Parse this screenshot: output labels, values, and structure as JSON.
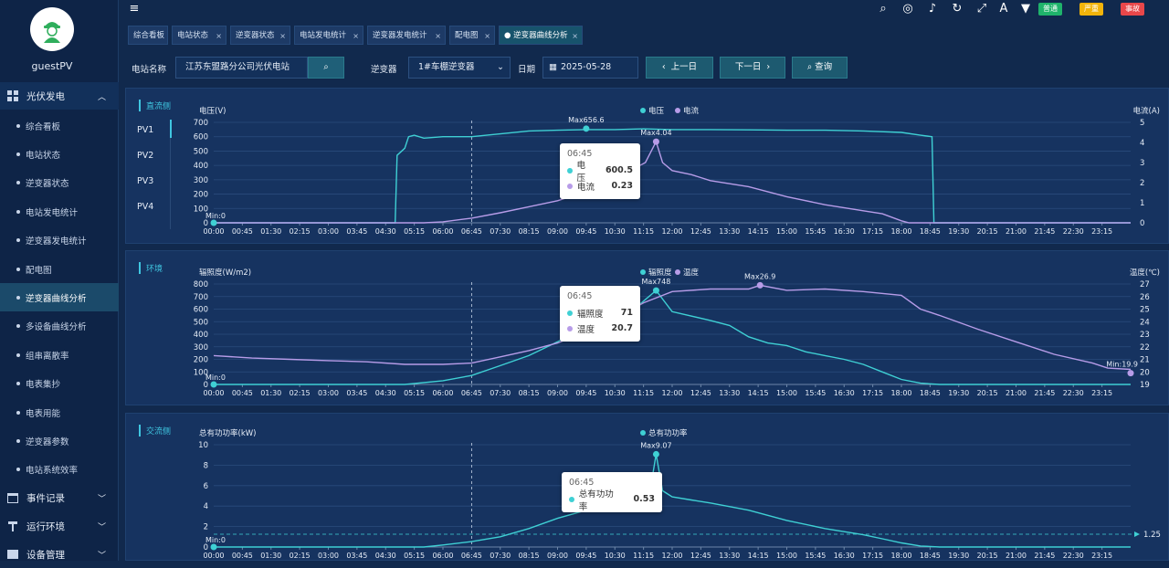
{
  "user": {
    "name": "guestPV"
  },
  "sidebar": {
    "groups": [
      {
        "label": "光伏发电",
        "expanded": true
      },
      {
        "label": "事件记录",
        "expanded": false
      },
      {
        "label": "运行环境",
        "expanded": false
      },
      {
        "label": "设备管理",
        "expanded": false
      }
    ],
    "items": [
      "综合看板",
      "电站状态",
      "逆变器状态",
      "电站发电统计",
      "逆变器发电统计",
      "配电图",
      "逆变器曲线分析",
      "多设备曲线分析",
      "组串离散率",
      "电表集抄",
      "电表用能",
      "逆变器参数",
      "电站系统效率"
    ],
    "active_item": "逆变器曲线分析"
  },
  "topbar": {
    "badges": [
      {
        "label": "普通",
        "color": "#1fb36b"
      },
      {
        "label": "严重",
        "color": "#f2b40a"
      },
      {
        "label": "事故",
        "color": "#e8474a"
      }
    ]
  },
  "tabs": [
    "综合看板",
    "电站状态",
    "逆变器状态",
    "电站发电统计",
    "逆变器发电统计",
    "配电图",
    "逆变器曲线分析"
  ],
  "active_tab": "逆变器曲线分析",
  "filter": {
    "station_label": "电站名称",
    "station_value": "江苏东盟路分公司光伏电站",
    "inverter_label": "逆变器",
    "inverter_value": "1#车棚逆变器",
    "date_label": "日期",
    "date_value": "2025-05-28",
    "prev_label": "上一日",
    "next_label": "下一日",
    "query_label": "查询"
  },
  "dc_panel": {
    "title": "直流侧",
    "pv_list": [
      "PV1",
      "PV2",
      "PV3",
      "PV4"
    ],
    "tooltip": {
      "time": "06:45",
      "rows": [
        {
          "name": "电压",
          "value": "600.5"
        },
        {
          "name": "电流",
          "value": "0.23"
        }
      ]
    }
  },
  "env_panel": {
    "title": "环境",
    "tooltip": {
      "time": "06:45",
      "rows": [
        {
          "name": "辐照度",
          "value": "71"
        },
        {
          "name": "温度",
          "value": "20.7"
        }
      ]
    }
  },
  "ac_panel": {
    "title": "交流侧",
    "tooltip": {
      "time": "06:45",
      "rows": [
        {
          "name": "总有功功率",
          "value": "0.53"
        }
      ]
    }
  },
  "chart_data": [
    {
      "type": "line",
      "x_ticks": [
        "00:00",
        "00:45",
        "01:30",
        "02:15",
        "03:00",
        "03:45",
        "04:30",
        "05:15",
        "06:00",
        "06:45",
        "07:30",
        "08:15",
        "09:00",
        "09:45",
        "10:30",
        "11:15",
        "12:00",
        "12:45",
        "13:30",
        "14:15",
        "15:00",
        "15:45",
        "16:30",
        "17:15",
        "18:00",
        "18:45",
        "19:30",
        "20:15",
        "21:00",
        "21:45",
        "22:30",
        "23:15"
      ],
      "ylabel": "电压(V)",
      "ylim": [
        0,
        700
      ],
      "y_ticks": [
        0,
        100,
        200,
        300,
        400,
        500,
        600,
        700
      ],
      "y2label": "电流(A)",
      "y2lim": [
        0,
        5
      ],
      "y2_ticks": [
        0,
        1,
        2,
        3,
        4,
        5
      ],
      "legend": [
        "电压",
        "电流"
      ],
      "series": [
        {
          "name": "电压",
          "axis": "left",
          "color": "#3fd0d4",
          "points": [
            [
              0,
              0
            ],
            [
              4.75,
              0
            ],
            [
              4.8,
              470
            ],
            [
              5.0,
              520
            ],
            [
              5.1,
              600
            ],
            [
              5.25,
              610
            ],
            [
              5.5,
              590
            ],
            [
              6.0,
              600
            ],
            [
              6.75,
              600
            ],
            [
              7.5,
              620
            ],
            [
              8.25,
              640
            ],
            [
              9.0,
              645
            ],
            [
              9.75,
              650
            ],
            [
              10.5,
              650
            ],
            [
              11.25,
              655
            ],
            [
              12.0,
              650
            ],
            [
              13.0,
              650
            ],
            [
              14.0,
              648
            ],
            [
              15.0,
              645
            ],
            [
              16.0,
              645
            ],
            [
              17.0,
              640
            ],
            [
              18.0,
              630
            ],
            [
              18.5,
              610
            ],
            [
              18.8,
              600
            ],
            [
              18.85,
              0
            ],
            [
              24,
              0
            ]
          ]
        },
        {
          "name": "电流",
          "axis": "right",
          "color": "#b79ce8",
          "points": [
            [
              0,
              0
            ],
            [
              5.5,
              0
            ],
            [
              6.0,
              0.05
            ],
            [
              6.75,
              0.23
            ],
            [
              7.5,
              0.5
            ],
            [
              8.25,
              0.8
            ],
            [
              9.0,
              1.1
            ],
            [
              9.5,
              1.4
            ],
            [
              10.0,
              1.8
            ],
            [
              10.5,
              2.4
            ],
            [
              11.0,
              2.7
            ],
            [
              11.3,
              3.0
            ],
            [
              11.58,
              4.04
            ],
            [
              11.75,
              3.0
            ],
            [
              12.0,
              2.6
            ],
            [
              12.5,
              2.4
            ],
            [
              13.0,
              2.1
            ],
            [
              14.0,
              1.8
            ],
            [
              15.0,
              1.3
            ],
            [
              16.0,
              0.9
            ],
            [
              17.0,
              0.6
            ],
            [
              17.5,
              0.45
            ],
            [
              18.0,
              0.1
            ],
            [
              18.2,
              0
            ],
            [
              24,
              0
            ]
          ]
        }
      ],
      "annotations": [
        "Max656.6",
        "Max4.04",
        "Min:0"
      ]
    },
    {
      "type": "line",
      "x_ticks": [
        "00:00",
        "00:45",
        "01:30",
        "02:15",
        "03:00",
        "03:45",
        "04:30",
        "05:15",
        "06:00",
        "06:45",
        "07:30",
        "08:15",
        "09:00",
        "09:45",
        "10:30",
        "11:15",
        "12:00",
        "12:45",
        "13:30",
        "14:15",
        "15:00",
        "15:45",
        "16:30",
        "17:15",
        "18:00",
        "18:45",
        "19:30",
        "20:15",
        "21:00",
        "21:45",
        "22:30",
        "23:15"
      ],
      "ylabel": "辐照度(W/m2)",
      "ylim": [
        0,
        800
      ],
      "y_ticks": [
        0,
        100,
        200,
        300,
        400,
        500,
        600,
        700,
        800
      ],
      "y2label": "温度(℃)",
      "y2lim": [
        19,
        27
      ],
      "y2_ticks": [
        19,
        20,
        21,
        22,
        23,
        24,
        25,
        26,
        27
      ],
      "legend": [
        "辐照度",
        "温度"
      ],
      "series": [
        {
          "name": "辐照度",
          "axis": "left",
          "color": "#3fd0d4",
          "points": [
            [
              0,
              0
            ],
            [
              5.0,
              0
            ],
            [
              6.0,
              30
            ],
            [
              6.75,
              71
            ],
            [
              7.5,
              150
            ],
            [
              8.25,
              230
            ],
            [
              9.0,
              340
            ],
            [
              9.75,
              470
            ],
            [
              10.5,
              560
            ],
            [
              11.0,
              600
            ],
            [
              11.58,
              748
            ],
            [
              12.0,
              580
            ],
            [
              13.0,
              510
            ],
            [
              13.5,
              470
            ],
            [
              14.0,
              380
            ],
            [
              14.5,
              330
            ],
            [
              15.0,
              310
            ],
            [
              15.5,
              260
            ],
            [
              16.0,
              230
            ],
            [
              16.5,
              200
            ],
            [
              17.0,
              160
            ],
            [
              17.5,
              100
            ],
            [
              18.0,
              40
            ],
            [
              18.5,
              10
            ],
            [
              19.0,
              0
            ],
            [
              24,
              0
            ]
          ]
        },
        {
          "name": "温度",
          "axis": "right",
          "color": "#b79ce8",
          "points": [
            [
              0,
              21.3
            ],
            [
              1.0,
              21.1
            ],
            [
              2.0,
              21.0
            ],
            [
              3.0,
              20.9
            ],
            [
              4.0,
              20.8
            ],
            [
              5.0,
              20.6
            ],
            [
              6.0,
              20.6
            ],
            [
              6.75,
              20.7
            ],
            [
              7.5,
              21.2
            ],
            [
              8.25,
              21.7
            ],
            [
              9.0,
              22.3
            ],
            [
              9.75,
              23.2
            ],
            [
              10.5,
              24.2
            ],
            [
              11.25,
              25.5
            ],
            [
              12.0,
              26.4
            ],
            [
              13.0,
              26.6
            ],
            [
              14.0,
              26.6
            ],
            [
              14.3,
              26.9
            ],
            [
              15.0,
              26.5
            ],
            [
              16.0,
              26.6
            ],
            [
              17.0,
              26.4
            ],
            [
              18.0,
              26.1
            ],
            [
              18.5,
              25.0
            ],
            [
              19.0,
              24.5
            ],
            [
              20.0,
              23.4
            ],
            [
              21.0,
              22.4
            ],
            [
              22.0,
              21.4
            ],
            [
              23.0,
              20.7
            ],
            [
              23.4,
              20.3
            ],
            [
              24,
              20.2
            ]
          ]
        }
      ],
      "annotations": [
        "Max748",
        "Max26.9",
        "Min:0",
        "Min:19.9"
      ]
    },
    {
      "type": "line",
      "x_ticks": [
        "00:00",
        "00:45",
        "01:30",
        "02:15",
        "03:00",
        "03:45",
        "04:30",
        "05:15",
        "06:00",
        "06:45",
        "07:30",
        "08:15",
        "09:00",
        "09:45",
        "10:30",
        "11:15",
        "12:00",
        "12:45",
        "13:30",
        "14:15",
        "15:00",
        "15:45",
        "16:30",
        "17:15",
        "18:00",
        "18:45",
        "19:30",
        "20:15",
        "21:00",
        "21:45",
        "22:30",
        "23:15"
      ],
      "ylabel": "总有功功率(kW)",
      "ylim": [
        0,
        10
      ],
      "y_ticks": [
        0,
        2,
        4,
        6,
        8,
        10
      ],
      "legend": [
        "总有功功率"
      ],
      "series": [
        {
          "name": "总有功功率",
          "axis": "left",
          "color": "#3fd0d4",
          "points": [
            [
              0,
              0
            ],
            [
              5.5,
              0
            ],
            [
              6.0,
              0.2
            ],
            [
              6.75,
              0.53
            ],
            [
              7.5,
              1.0
            ],
            [
              8.25,
              1.8
            ],
            [
              9.0,
              2.8
            ],
            [
              9.75,
              3.6
            ],
            [
              10.5,
              4.2
            ],
            [
              11.0,
              4.6
            ],
            [
              11.4,
              5.0
            ],
            [
              11.58,
              9.07
            ],
            [
              11.75,
              5.5
            ],
            [
              12.0,
              4.9
            ],
            [
              12.5,
              4.6
            ],
            [
              13.0,
              4.3
            ],
            [
              14.0,
              3.6
            ],
            [
              15.0,
              2.6
            ],
            [
              16.0,
              1.8
            ],
            [
              17.0,
              1.2
            ],
            [
              17.5,
              0.8
            ],
            [
              18.0,
              0.4
            ],
            [
              18.5,
              0.1
            ],
            [
              19.0,
              0
            ],
            [
              24,
              0
            ]
          ]
        }
      ],
      "markline": {
        "value": 1.25,
        "label": "1.25"
      },
      "annotations": [
        "Max9.07",
        "Min:0"
      ]
    }
  ]
}
